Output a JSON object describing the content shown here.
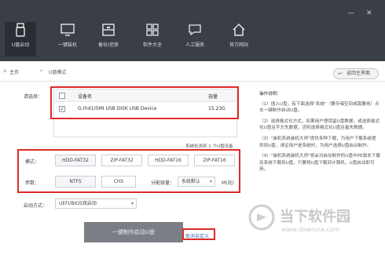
{
  "toolbar": {
    "items": [
      {
        "label": "U盘启动",
        "icon": "usb-drive-icon",
        "active": true
      },
      {
        "label": "一键装机",
        "icon": "monitor-icon"
      },
      {
        "label": "备份/还原",
        "icon": "backup-icon"
      },
      {
        "label": "软件大全",
        "icon": "apps-grid-icon"
      },
      {
        "label": "人工服务",
        "icon": "chat-icon"
      },
      {
        "label": "官方网站",
        "icon": "home-icon"
      }
    ],
    "window_controls": {
      "minimize": "—",
      "close": "✕"
    }
  },
  "breadcrumb": {
    "home": "主页",
    "separator": ">",
    "current": "U盘模式"
  },
  "back_button": {
    "label": "返回主界面"
  },
  "device": {
    "label": "请选择：",
    "columns": {
      "device_name": "设备名",
      "capacity": "容量"
    },
    "rows": [
      {
        "name": "G:(hd1)SMI USB DISK USB Device",
        "capacity": "15.23G",
        "checked": true
      }
    ],
    "detected_text": "系统检测到 1 个U盘设备"
  },
  "mode": {
    "label": "模式：",
    "options": [
      "HDD-FAT32",
      "ZIP-FAT32",
      "HDD-FAT16",
      "ZIP-FAT16"
    ]
  },
  "params": {
    "label": "参数：",
    "fs_options": [
      "NTFS",
      "CHS"
    ],
    "alloc_label": "分配容量：",
    "alloc_value": "系统默认",
    "unit": "M(兆)"
  },
  "boot": {
    "label": "启动方式：",
    "value": "UEFI/BIOS双启动"
  },
  "actions": {
    "start": "一键制作启动U盘",
    "custom": "取消自定义"
  },
  "help": {
    "title": "操作说明：",
    "paragraphs": [
      "（1）插入U盘，有下面选择\"系统\"（要存储空间或需要用）点击一键制作启动U盘。",
      "（2）选择格式化方式，如果用户想保留U盘数据，或选择格式化U盘且不方失数据，否则选择格式化U盘且备失数据。",
      "（3）\"装机系统装机大师\"提供多种下载，为用户下载系统提供到U盘，请证用户是系统时，为用户选择U盘启动制作。",
      "（4）\"装机系统装机大师\"将会对启动制作的U盘中PE版本下载及系统下载到U盘，只要将U盘下载到计算机，U盘启动即可用。"
    ]
  },
  "watermark": {
    "line1": "当下软件园",
    "line2": "www.downxia.com"
  },
  "colors": {
    "toolbar_bg": "#3a3f47",
    "highlight_red": "#e02a2a",
    "start_button": "#7b7f85",
    "link_blue": "#3b6fb6"
  }
}
